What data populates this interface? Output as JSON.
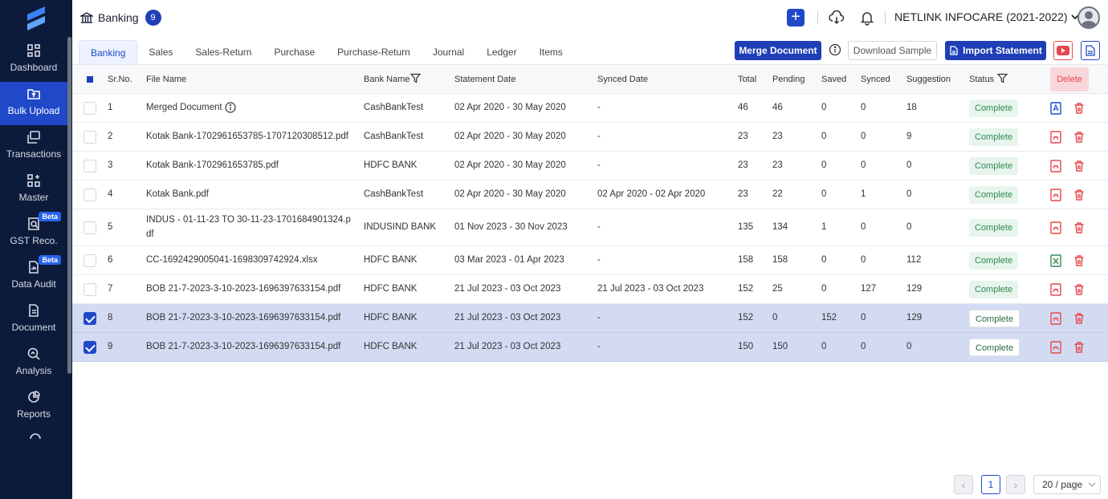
{
  "sidebar": {
    "items": [
      {
        "label": "Dashboard",
        "icon": "dashboard-icon"
      },
      {
        "label": "Bulk Upload",
        "icon": "upload-icon"
      },
      {
        "label": "Transactions",
        "icon": "transactions-icon"
      },
      {
        "label": "Master",
        "icon": "master-icon"
      },
      {
        "label": "GST Reco.",
        "icon": "gst-reco-icon",
        "badge": "Beta"
      },
      {
        "label": "Data Audit",
        "icon": "data-audit-icon",
        "badge": "Beta"
      },
      {
        "label": "Document",
        "icon": "document-icon"
      },
      {
        "label": "Analysis",
        "icon": "analysis-icon"
      },
      {
        "label": "Reports",
        "icon": "reports-icon"
      }
    ]
  },
  "header": {
    "title": "Banking",
    "count": "9",
    "company": "NETLINK INFOCARE (2021-2022)"
  },
  "tabs": [
    "Banking",
    "Sales",
    "Sales-Return",
    "Purchase",
    "Purchase-Return",
    "Journal",
    "Ledger",
    "Items"
  ],
  "toolbar": {
    "merge_label": "Merge Document",
    "download_label": "Download Sample",
    "import_label": "Import Statement"
  },
  "table": {
    "columns": {
      "sr": "Sr.No.",
      "file": "File Name",
      "bank": "Bank Name",
      "statement": "Statement Date",
      "synced_date": "Synced Date",
      "total": "Total",
      "pending": "Pending",
      "saved": "Saved",
      "synced": "Synced",
      "suggestion": "Suggestion",
      "status": "Status",
      "delete": "Delete"
    },
    "rows": [
      {
        "sr": "1",
        "file": "Merged Document",
        "bank": "CashBankTest",
        "statement": "02 Apr 2020 - 30 May 2020",
        "synced_date": "-",
        "total": "46",
        "pending": "46",
        "saved": "0",
        "synced": "0",
        "suggestion": "18",
        "status": "Complete",
        "doc": "doc",
        "selected": false,
        "info": true
      },
      {
        "sr": "2",
        "file": "Kotak Bank-1702961653785-1707120308512.pdf",
        "bank": "CashBankTest",
        "statement": "02 Apr 2020 - 30 May 2020",
        "synced_date": "-",
        "total": "23",
        "pending": "23",
        "saved": "0",
        "synced": "0",
        "suggestion": "9",
        "status": "Complete",
        "doc": "pdf",
        "selected": false
      },
      {
        "sr": "3",
        "file": "Kotak Bank-1702961653785.pdf",
        "bank": "HDFC BANK",
        "statement": "02 Apr 2020 - 30 May 2020",
        "synced_date": "-",
        "total": "23",
        "pending": "23",
        "saved": "0",
        "synced": "0",
        "suggestion": "0",
        "status": "Complete",
        "doc": "pdf",
        "selected": false
      },
      {
        "sr": "4",
        "file": "Kotak Bank.pdf",
        "bank": "CashBankTest",
        "statement": "02 Apr 2020 - 30 May 2020",
        "synced_date": "02 Apr 2020 - 02 Apr 2020",
        "total": "23",
        "pending": "22",
        "saved": "0",
        "synced": "1",
        "suggestion": "0",
        "status": "Complete",
        "doc": "pdf",
        "selected": false
      },
      {
        "sr": "5",
        "file": "INDUS - 01-11-23 TO 30-11-23-1701684901324.p",
        "file2": "df",
        "bank": "INDUSIND BANK",
        "statement": "01 Nov 2023 - 30 Nov 2023",
        "synced_date": "-",
        "total": "135",
        "pending": "134",
        "saved": "1",
        "synced": "0",
        "suggestion": "0",
        "status": "Complete",
        "doc": "pdf",
        "selected": false
      },
      {
        "sr": "6",
        "file": "CC-1692429005041-1698309742924.xlsx",
        "bank": "HDFC BANK",
        "statement": "03 Mar 2023 - 01 Apr 2023",
        "synced_date": "-",
        "total": "158",
        "pending": "158",
        "saved": "0",
        "synced": "0",
        "suggestion": "112",
        "status": "Complete",
        "doc": "xls",
        "selected": false
      },
      {
        "sr": "7",
        "file": "BOB 21-7-2023-3-10-2023-1696397633154.pdf",
        "bank": "HDFC BANK",
        "statement": "21 Jul 2023 - 03 Oct 2023",
        "synced_date": "21 Jul 2023 - 03 Oct 2023",
        "total": "152",
        "pending": "25",
        "saved": "0",
        "synced": "127",
        "suggestion": "129",
        "status": "Complete",
        "doc": "pdf",
        "selected": false
      },
      {
        "sr": "8",
        "file": "BOB 21-7-2023-3-10-2023-1696397633154.pdf",
        "bank": "HDFC BANK",
        "statement": "21 Jul 2023 - 03 Oct 2023",
        "synced_date": "-",
        "total": "152",
        "pending": "0",
        "saved": "152",
        "synced": "0",
        "suggestion": "129",
        "status": "Complete",
        "doc": "pdf",
        "selected": true
      },
      {
        "sr": "9",
        "file": "BOB 21-7-2023-3-10-2023-1696397633154.pdf",
        "bank": "HDFC BANK",
        "statement": "21 Jul 2023 - 03 Oct 2023",
        "synced_date": "-",
        "total": "150",
        "pending": "150",
        "saved": "0",
        "synced": "0",
        "suggestion": "0",
        "status": "Complete",
        "doc": "pdf",
        "selected": true
      }
    ]
  },
  "pagination": {
    "current": "1",
    "page_size": "20 / page"
  },
  "colors": {
    "sidebar_bg": "#0d1b3b",
    "accent": "#1f49c9",
    "danger": "#e5484d",
    "status_green": "#2e8b57"
  }
}
